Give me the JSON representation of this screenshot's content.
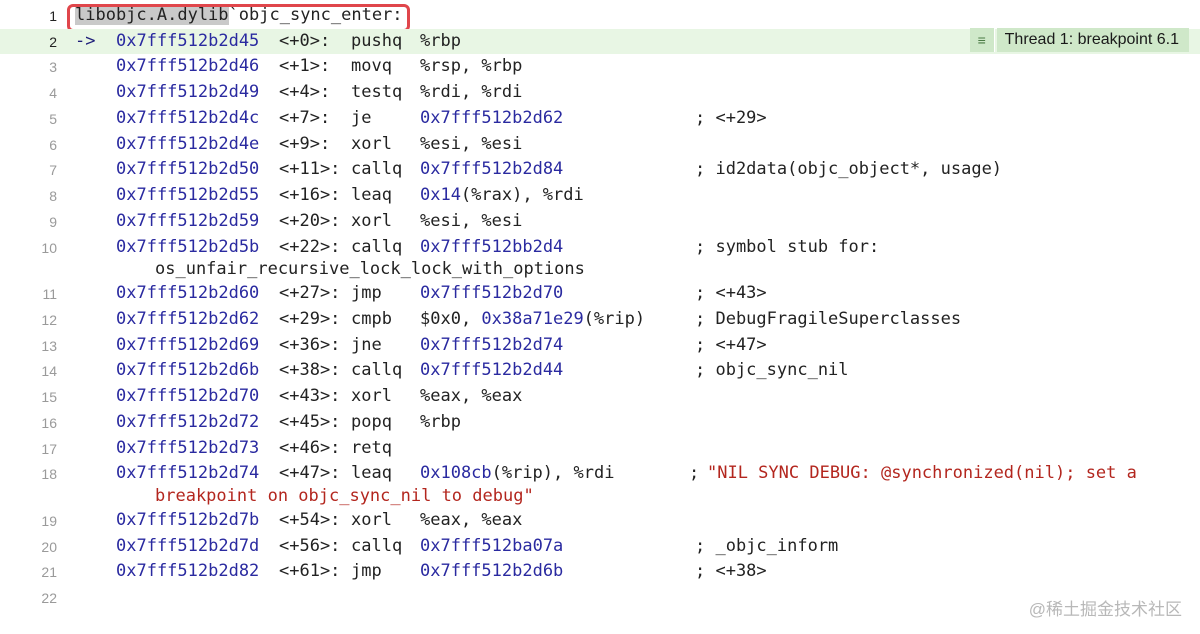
{
  "editor": {
    "header": {
      "number": "1",
      "library": "libobjc.A.dylib",
      "separator": "`",
      "function": "objc_sync_enter:"
    },
    "thread_badge": {
      "icon": "menu-lines-icon",
      "label": "Thread 1: breakpoint 6.1"
    },
    "lines": [
      {
        "n": "2",
        "arrow": "->",
        "addr": "0x7fff512b2d45",
        "off": "<+0>:",
        "mn": "pushq",
        "ops": "%rbp",
        "cmt": ""
      },
      {
        "n": "3",
        "addr": "0x7fff512b2d46",
        "off": "<+1>:",
        "mn": "movq",
        "ops": "%rsp, %rbp",
        "cmt": ""
      },
      {
        "n": "4",
        "addr": "0x7fff512b2d49",
        "off": "<+4>:",
        "mn": "testq",
        "ops": "%rdi, %rdi",
        "cmt": ""
      },
      {
        "n": "5",
        "addr": "0x7fff512b2d4c",
        "off": "<+7>:",
        "mn": "je",
        "target": "0x7fff512b2d62",
        "cmt": "; <+29>"
      },
      {
        "n": "6",
        "addr": "0x7fff512b2d4e",
        "off": "<+9>:",
        "mn": "xorl",
        "ops": "%esi, %esi",
        "cmt": ""
      },
      {
        "n": "7",
        "addr": "0x7fff512b2d50",
        "off": "<+11>:",
        "mn": "callq",
        "target": "0x7fff512b2d84",
        "cmt": "; id2data(objc_object*, usage)"
      },
      {
        "n": "8",
        "addr": "0x7fff512b2d55",
        "off": "<+16>:",
        "mn": "leaq",
        "target": "0x14",
        "ops": "(%rax), %rdi",
        "cmt": ""
      },
      {
        "n": "9",
        "addr": "0x7fff512b2d59",
        "off": "<+20>:",
        "mn": "xorl",
        "ops": "%esi, %esi",
        "cmt": ""
      },
      {
        "n": "10",
        "addr": "0x7fff512b2d5b",
        "off": "<+22>:",
        "mn": "callq",
        "target": "0x7fff512bb2d4",
        "cmt": "; symbol stub for:",
        "cont": "os_unfair_recursive_lock_lock_with_options"
      },
      {
        "n": "11",
        "addr": "0x7fff512b2d60",
        "off": "<+27>:",
        "mn": "jmp",
        "target": "0x7fff512b2d70",
        "cmt": "; <+43>"
      },
      {
        "n": "12",
        "addr": "0x7fff512b2d62",
        "off": "<+29>:",
        "mn": "cmpb",
        "ops": "$0x0, ",
        "target": "0x38a71e29",
        "ops2": "(%rip)",
        "cmt": "; DebugFragileSuperclasses"
      },
      {
        "n": "13",
        "addr": "0x7fff512b2d69",
        "off": "<+36>:",
        "mn": "jne",
        "target": "0x7fff512b2d74",
        "cmt": "; <+47>"
      },
      {
        "n": "14",
        "addr": "0x7fff512b2d6b",
        "off": "<+38>:",
        "mn": "callq",
        "target": "0x7fff512b2d44",
        "cmt": "; objc_sync_nil"
      },
      {
        "n": "15",
        "addr": "0x7fff512b2d70",
        "off": "<+43>:",
        "mn": "xorl",
        "ops": "%eax, %eax",
        "cmt": ""
      },
      {
        "n": "16",
        "addr": "0x7fff512b2d72",
        "off": "<+45>:",
        "mn": "popq",
        "ops": "%rbp",
        "cmt": ""
      },
      {
        "n": "17",
        "addr": "0x7fff512b2d73",
        "off": "<+46>:",
        "mn": "retq",
        "cmt": ""
      },
      {
        "n": "18",
        "addr": "0x7fff512b2d74",
        "off": "<+47>:",
        "mn": "leaq",
        "target": "0x108cb",
        "ops": "(%rip), %rdi",
        "cmt": ";",
        "str": "\"NIL SYNC DEBUG: @synchronized(nil); set a",
        "cont_str": "breakpoint on objc_sync_nil to debug\""
      },
      {
        "n": "19",
        "addr": "0x7fff512b2d7b",
        "off": "<+54>:",
        "mn": "xorl",
        "ops": "%eax, %eax",
        "cmt": ""
      },
      {
        "n": "20",
        "addr": "0x7fff512b2d7d",
        "off": "<+56>:",
        "mn": "callq",
        "target": "0x7fff512ba07a",
        "cmt": "; _objc_inform"
      },
      {
        "n": "21",
        "addr": "0x7fff512b2d82",
        "off": "<+61>:",
        "mn": "jmp",
        "target": "0x7fff512b2d6b",
        "cmt": "; <+38>"
      },
      {
        "n": "22"
      }
    ]
  },
  "watermark": "@稀土掘金技术社区"
}
